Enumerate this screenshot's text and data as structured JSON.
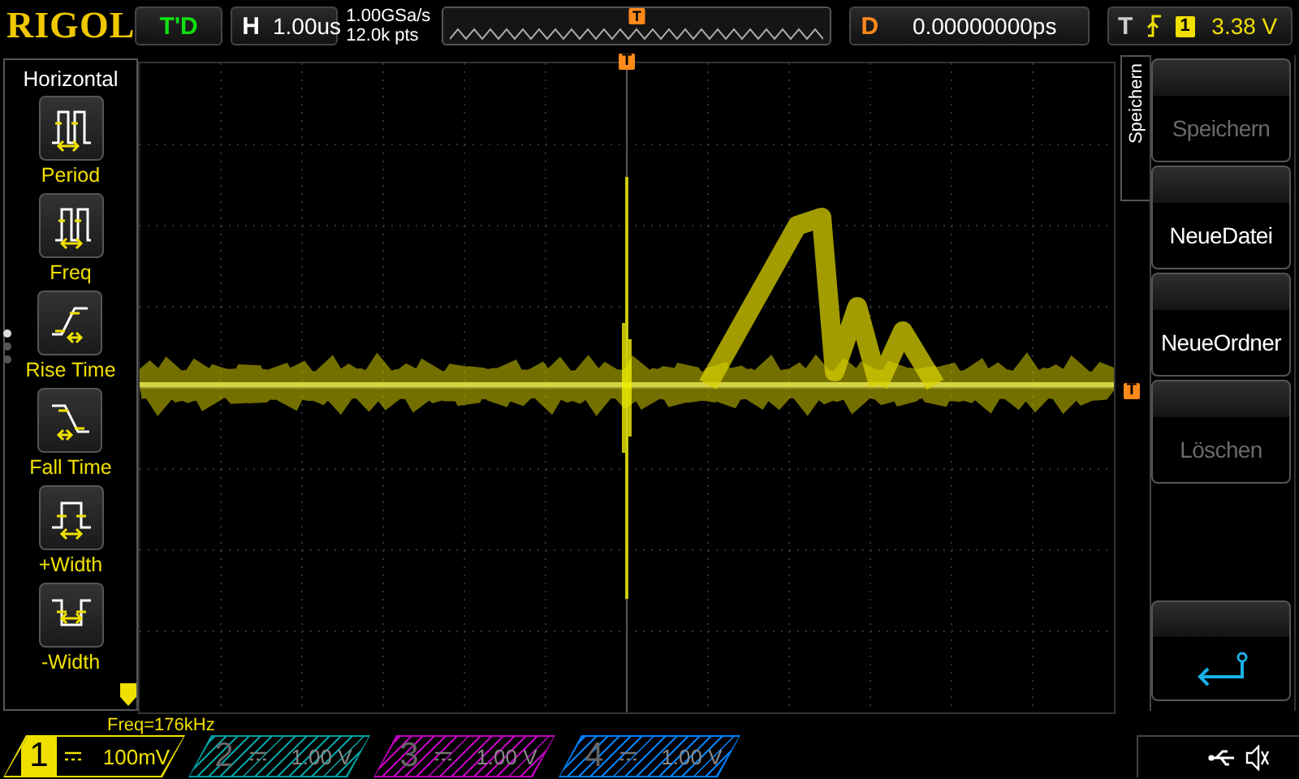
{
  "header": {
    "brand": "RIGOL",
    "run_status": "T'D",
    "horizontal": {
      "label": "H",
      "value": "1.00us"
    },
    "sample_rate": "1.00GSa/s",
    "memory_depth": "12.0k pts",
    "trigger_position_marker": "T",
    "delay": {
      "label": "D",
      "value": "0.00000000ps"
    },
    "trigger": {
      "label": "T",
      "source": "1",
      "level": "3.38 V"
    }
  },
  "left_menu": {
    "title": "Horizontal",
    "pages": [
      {
        "selected": true
      },
      {
        "selected": false
      },
      {
        "selected": false
      }
    ],
    "items": [
      {
        "kind": "period",
        "label": "Period"
      },
      {
        "kind": "freq",
        "label": "Freq"
      },
      {
        "kind": "rise",
        "label": "Rise Time"
      },
      {
        "kind": "fall",
        "label": "Fall Time"
      },
      {
        "kind": "pwidth",
        "label": "+Width"
      },
      {
        "kind": "nwidth",
        "label": "-Width"
      }
    ]
  },
  "screen": {
    "trigger_marker": "T",
    "level_marker": "T",
    "measurement": "Freq=176kHz"
  },
  "right_menu": {
    "title": "Speichern",
    "buttons": [
      {
        "label": "Speichern",
        "disabled": true
      },
      {
        "label": "NeueDatei",
        "disabled": false
      },
      {
        "label": "NeueOrdner",
        "disabled": false
      },
      {
        "label": "Löschen",
        "disabled": true
      }
    ]
  },
  "channels": [
    {
      "number": "1",
      "scale": "100mV",
      "active": true,
      "color": "#f0e000"
    },
    {
      "number": "2",
      "scale": "1.00 V",
      "active": false,
      "color": "#00a0a0"
    },
    {
      "number": "3",
      "scale": "1.00 V",
      "active": false,
      "color": "#c000c0"
    },
    {
      "number": "4",
      "scale": "1.00 V",
      "active": false,
      "color": "#0080ff"
    }
  ]
}
